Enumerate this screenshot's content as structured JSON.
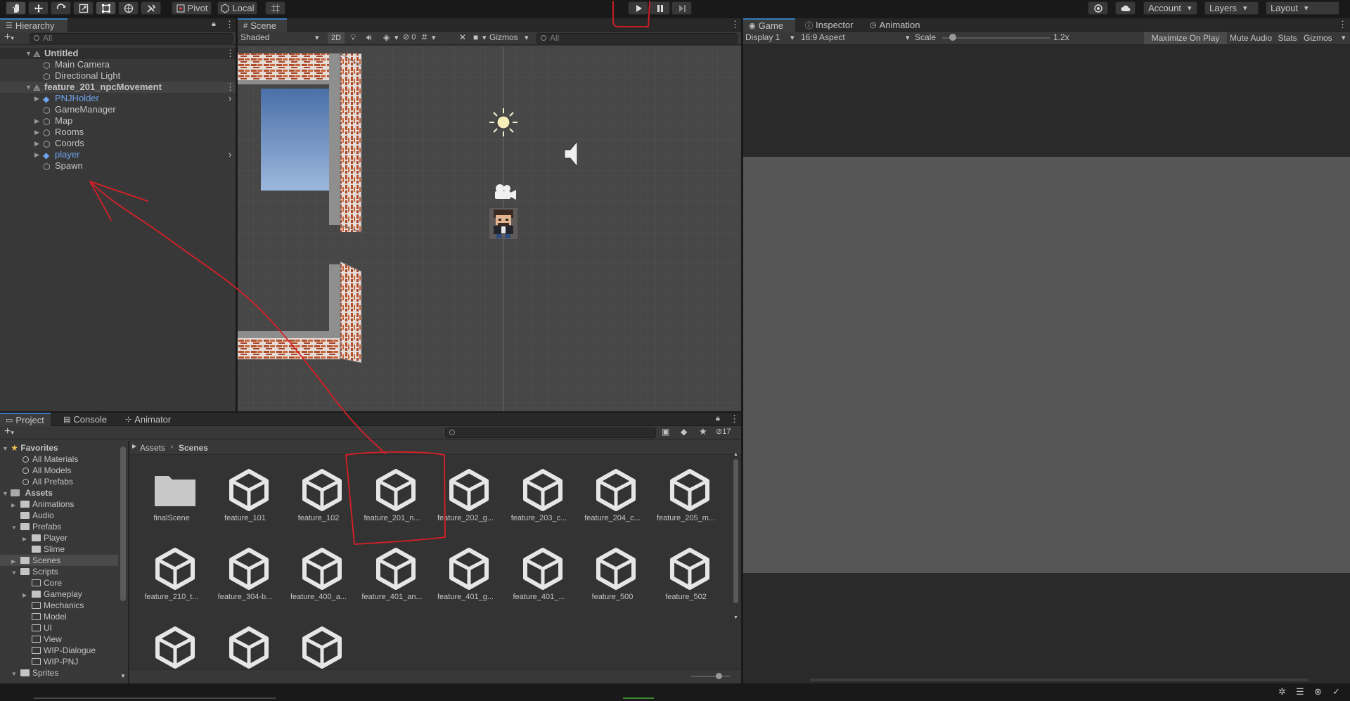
{
  "toolbar": {
    "pivot": "Pivot",
    "local": "Local",
    "account": "Account",
    "layers": "Layers",
    "layout": "Layout"
  },
  "hierarchy": {
    "tab": "Hierarchy",
    "search_placeholder": "All",
    "items": [
      {
        "label": "Untitled",
        "kind": "scene"
      },
      {
        "label": "Main Camera",
        "kind": "go"
      },
      {
        "label": "Directional Light",
        "kind": "go"
      },
      {
        "label": "feature_201_npcMovement",
        "kind": "scene"
      },
      {
        "label": "PNJHolder",
        "kind": "prefab"
      },
      {
        "label": "GameManager",
        "kind": "go"
      },
      {
        "label": "Map",
        "kind": "go"
      },
      {
        "label": "Rooms",
        "kind": "go"
      },
      {
        "label": "Coords",
        "kind": "go"
      },
      {
        "label": "player",
        "kind": "prefab"
      },
      {
        "label": "Spawn",
        "kind": "go"
      }
    ]
  },
  "scene": {
    "tab": "Scene",
    "shading": "Shaded",
    "mode2d": "2D",
    "hidden_count": "0",
    "gizmos": "Gizmos",
    "search_placeholder": "All"
  },
  "game": {
    "tabs": [
      "Game",
      "Inspector",
      "Animation"
    ],
    "display": "Display 1",
    "aspect": "16:9 Aspect",
    "scale_label": "Scale",
    "scale_value": 0.1,
    "scale_text": "1.2x",
    "maximize": "Maximize On Play",
    "mute": "Mute Audio",
    "stats": "Stats",
    "gizmos": "Gizmos"
  },
  "project": {
    "tabs": [
      "Project",
      "Console",
      "Animator"
    ],
    "hidden_count": "17",
    "breadcrumb": [
      "Assets",
      "Scenes"
    ],
    "favorites": {
      "title": "Favorites",
      "items": [
        "All Materials",
        "All Models",
        "All Prefabs"
      ]
    },
    "assets_root": "Assets",
    "tree": [
      {
        "label": "Animations",
        "depth": 1,
        "fold": "closed"
      },
      {
        "label": "Audio",
        "depth": 1,
        "fold": "none"
      },
      {
        "label": "Prefabs",
        "depth": 1,
        "fold": "open"
      },
      {
        "label": "Player",
        "depth": 2,
        "fold": "closed"
      },
      {
        "label": "Slime",
        "depth": 2,
        "fold": "none"
      },
      {
        "label": "Scenes",
        "depth": 1,
        "fold": "closed"
      },
      {
        "label": "Scripts",
        "depth": 1,
        "fold": "open"
      },
      {
        "label": "Core",
        "depth": 2,
        "fold": "none"
      },
      {
        "label": "Gameplay",
        "depth": 2,
        "fold": "closed"
      },
      {
        "label": "Mechanics",
        "depth": 2,
        "fold": "none"
      },
      {
        "label": "Model",
        "depth": 2,
        "fold": "none"
      },
      {
        "label": "UI",
        "depth": 2,
        "fold": "none"
      },
      {
        "label": "View",
        "depth": 2,
        "fold": "none"
      },
      {
        "label": "WIP-Dialogue",
        "depth": 2,
        "fold": "none"
      },
      {
        "label": "WIP-PNJ",
        "depth": 2,
        "fold": "none"
      },
      {
        "label": "Sprites",
        "depth": 1,
        "fold": "open"
      }
    ],
    "assets": [
      {
        "label": "finalScene",
        "type": "folder"
      },
      {
        "label": "feature_101",
        "type": "scene"
      },
      {
        "label": "feature_102",
        "type": "scene"
      },
      {
        "label": "feature_201_n...",
        "type": "scene"
      },
      {
        "label": "feature_202_g...",
        "type": "scene"
      },
      {
        "label": "feature_203_c...",
        "type": "scene"
      },
      {
        "label": "feature_204_c...",
        "type": "scene"
      },
      {
        "label": "feature_205_m...",
        "type": "scene"
      },
      {
        "label": "feature_210_t...",
        "type": "scene"
      },
      {
        "label": "feature_304-b...",
        "type": "scene"
      },
      {
        "label": "feature_400_a...",
        "type": "scene"
      },
      {
        "label": "feature_401_an...",
        "type": "scene"
      },
      {
        "label": "feature_401_g...",
        "type": "scene"
      },
      {
        "label": "feature_401_...",
        "type": "scene"
      },
      {
        "label": "feature_500",
        "type": "scene"
      },
      {
        "label": "feature_502",
        "type": "scene"
      },
      {
        "label": "",
        "type": "scene"
      },
      {
        "label": "",
        "type": "scene"
      },
      {
        "label": "",
        "type": "scene"
      }
    ]
  },
  "colors": {
    "annotation": "#d91f26",
    "selection_blue": "#3a79bb",
    "prefab_text": "#6fa4ee"
  }
}
